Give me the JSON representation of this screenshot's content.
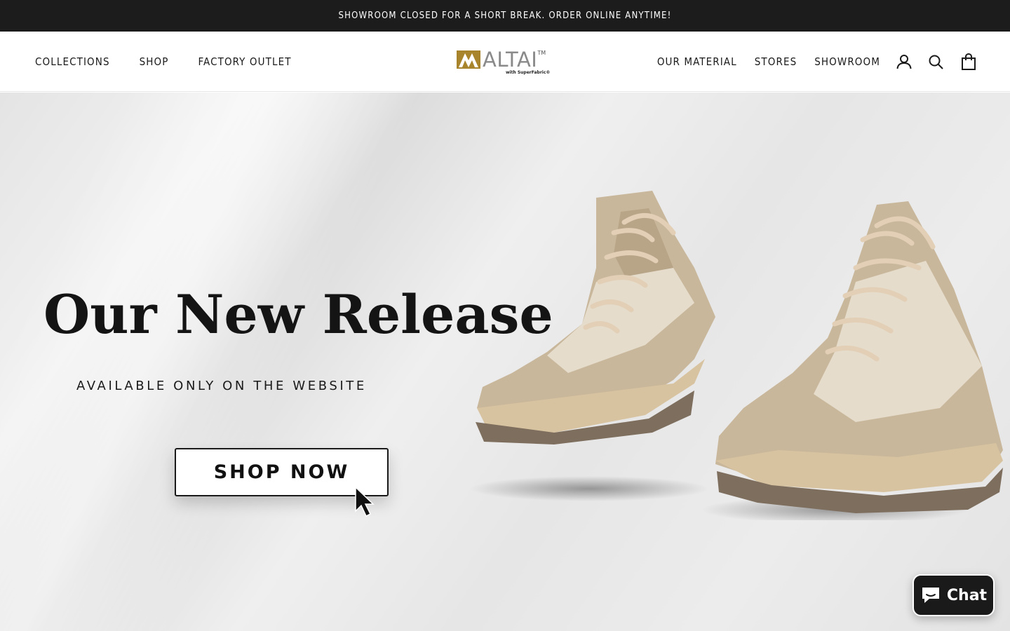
{
  "announcement": {
    "text": "SHOWROOM CLOSED FOR A SHORT BREAK. ORDER ONLINE ANYTIME!"
  },
  "header": {
    "nav_left": [
      {
        "label": "COLLECTIONS"
      },
      {
        "label": "SHOP"
      },
      {
        "label": "FACTORY OUTLET"
      }
    ],
    "logo": {
      "text": "ALTAI",
      "tm": "TM",
      "sub": "with SuperFabric®"
    },
    "nav_right": [
      {
        "label": "OUR MATERIAL"
      },
      {
        "label": "STORES"
      },
      {
        "label": "SHOWROOM"
      }
    ],
    "icons": [
      "account-icon",
      "search-icon",
      "cart-icon"
    ]
  },
  "hero": {
    "title": "Our New Release",
    "subtitle": "AVAILABLE ONLY ON THE WEBSITE",
    "cta_label": "SHOP NOW"
  },
  "chat": {
    "label": "Chat",
    "icon": "chat-bubble-icon"
  },
  "colors": {
    "announcement_bg": "#1c1c1c",
    "logo_gold": "#a8842c",
    "shoe_beige": "#c9b79b",
    "chat_bg": "#1a1a1a"
  }
}
